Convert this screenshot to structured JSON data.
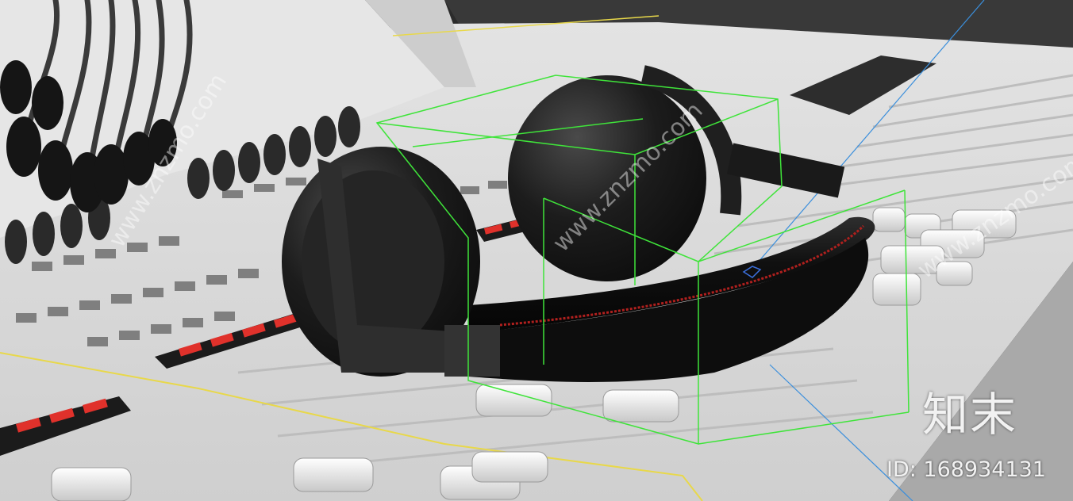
{
  "scene": {
    "subject": "headphones-on-mixing-console",
    "colors": {
      "console": "#dcdcdc",
      "console_shadow": "#b9b9b9",
      "background": "#2b2b2b",
      "headphone": "#1a1a1a",
      "stitch": "#b0201e",
      "selection_box": "#3fe43a",
      "yellow_line": "#e8d84a",
      "blue_line": "#3b8fdc",
      "led_red": "#e0312b"
    }
  },
  "watermark": {
    "logo": "知末",
    "id_text": "ID: 168934131",
    "diagonal_text": "www.znzmo.com"
  }
}
